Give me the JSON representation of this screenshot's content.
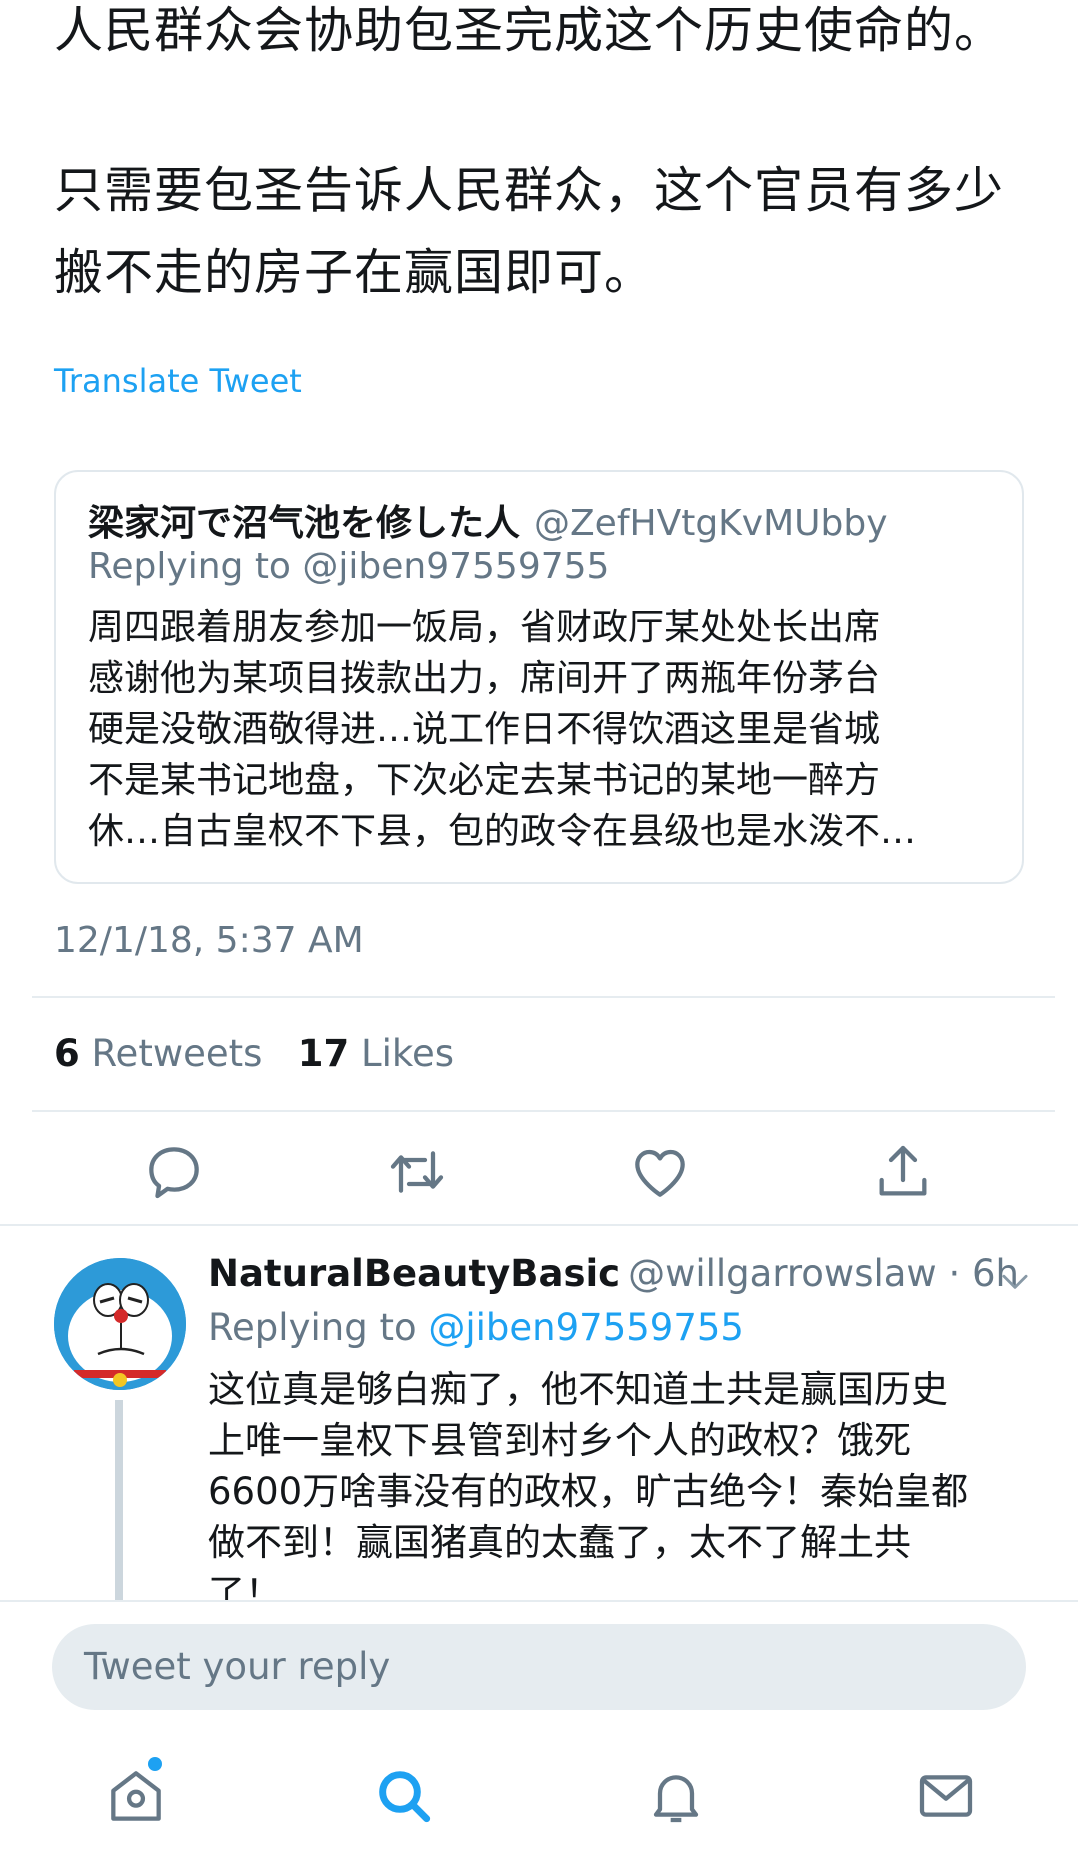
{
  "tweet": {
    "paragraph1": "人民群众会协助包圣完成这个历史使命的。",
    "paragraph2": "只需要包圣告诉人民群众，这个官员有多少搬不走的房子在赢国即可。",
    "translate_label": "Translate Tweet",
    "timestamp": "12/1/18, 5:37 AM"
  },
  "quoted_tweet": {
    "name": "梁家河で沼气池を修した人",
    "handle": "@ZefHVtgKvMUbby",
    "replying_to": "Replying to @jiben97559755",
    "body": "周四跟着朋友参加一饭局，省财政厅某处处长出席\n感谢他为某项目拨款出力，席间开了两瓶年份茅台\n硬是没敬酒敬得进…说工作日不得饮酒这里是省城\n不是某书记地盘，下次必定去某书记的某地一醉方\n休…自古皇权不下县，包的政令在县级也是水泼不…"
  },
  "stats": {
    "retweets_count": "6",
    "retweets_label": "Retweets",
    "likes_count": "17",
    "likes_label": "Likes"
  },
  "actions": {
    "reply_icon": "reply-icon",
    "retweet_icon": "retweet-icon",
    "like_icon": "heart-icon",
    "share_icon": "share-icon"
  },
  "reply": {
    "name": "NaturalBeautyBasic",
    "handle_time": "@willgarrowslaw · 6h",
    "replying_prefix": "Replying to",
    "replying_handle": "@jiben97559755",
    "body": "这位真是够白痴了，他不知道土共是赢国历史\n上唯一皇权下县管到村乡个人的政权？饿死\n6600万啥事没有的政权，旷古绝今！秦始皇都\n做不到！赢国猪真的太蠢了，太不了解土共\n了！"
  },
  "compose": {
    "placeholder": "Tweet your reply"
  },
  "tabbar": {
    "home_icon": "home-icon",
    "search_icon": "search-icon",
    "notifications_icon": "bell-icon",
    "messages_icon": "mail-icon"
  },
  "colors": {
    "accent": "#1da1f2",
    "secondary_text": "#657786",
    "divider": "#e6ecf0"
  }
}
